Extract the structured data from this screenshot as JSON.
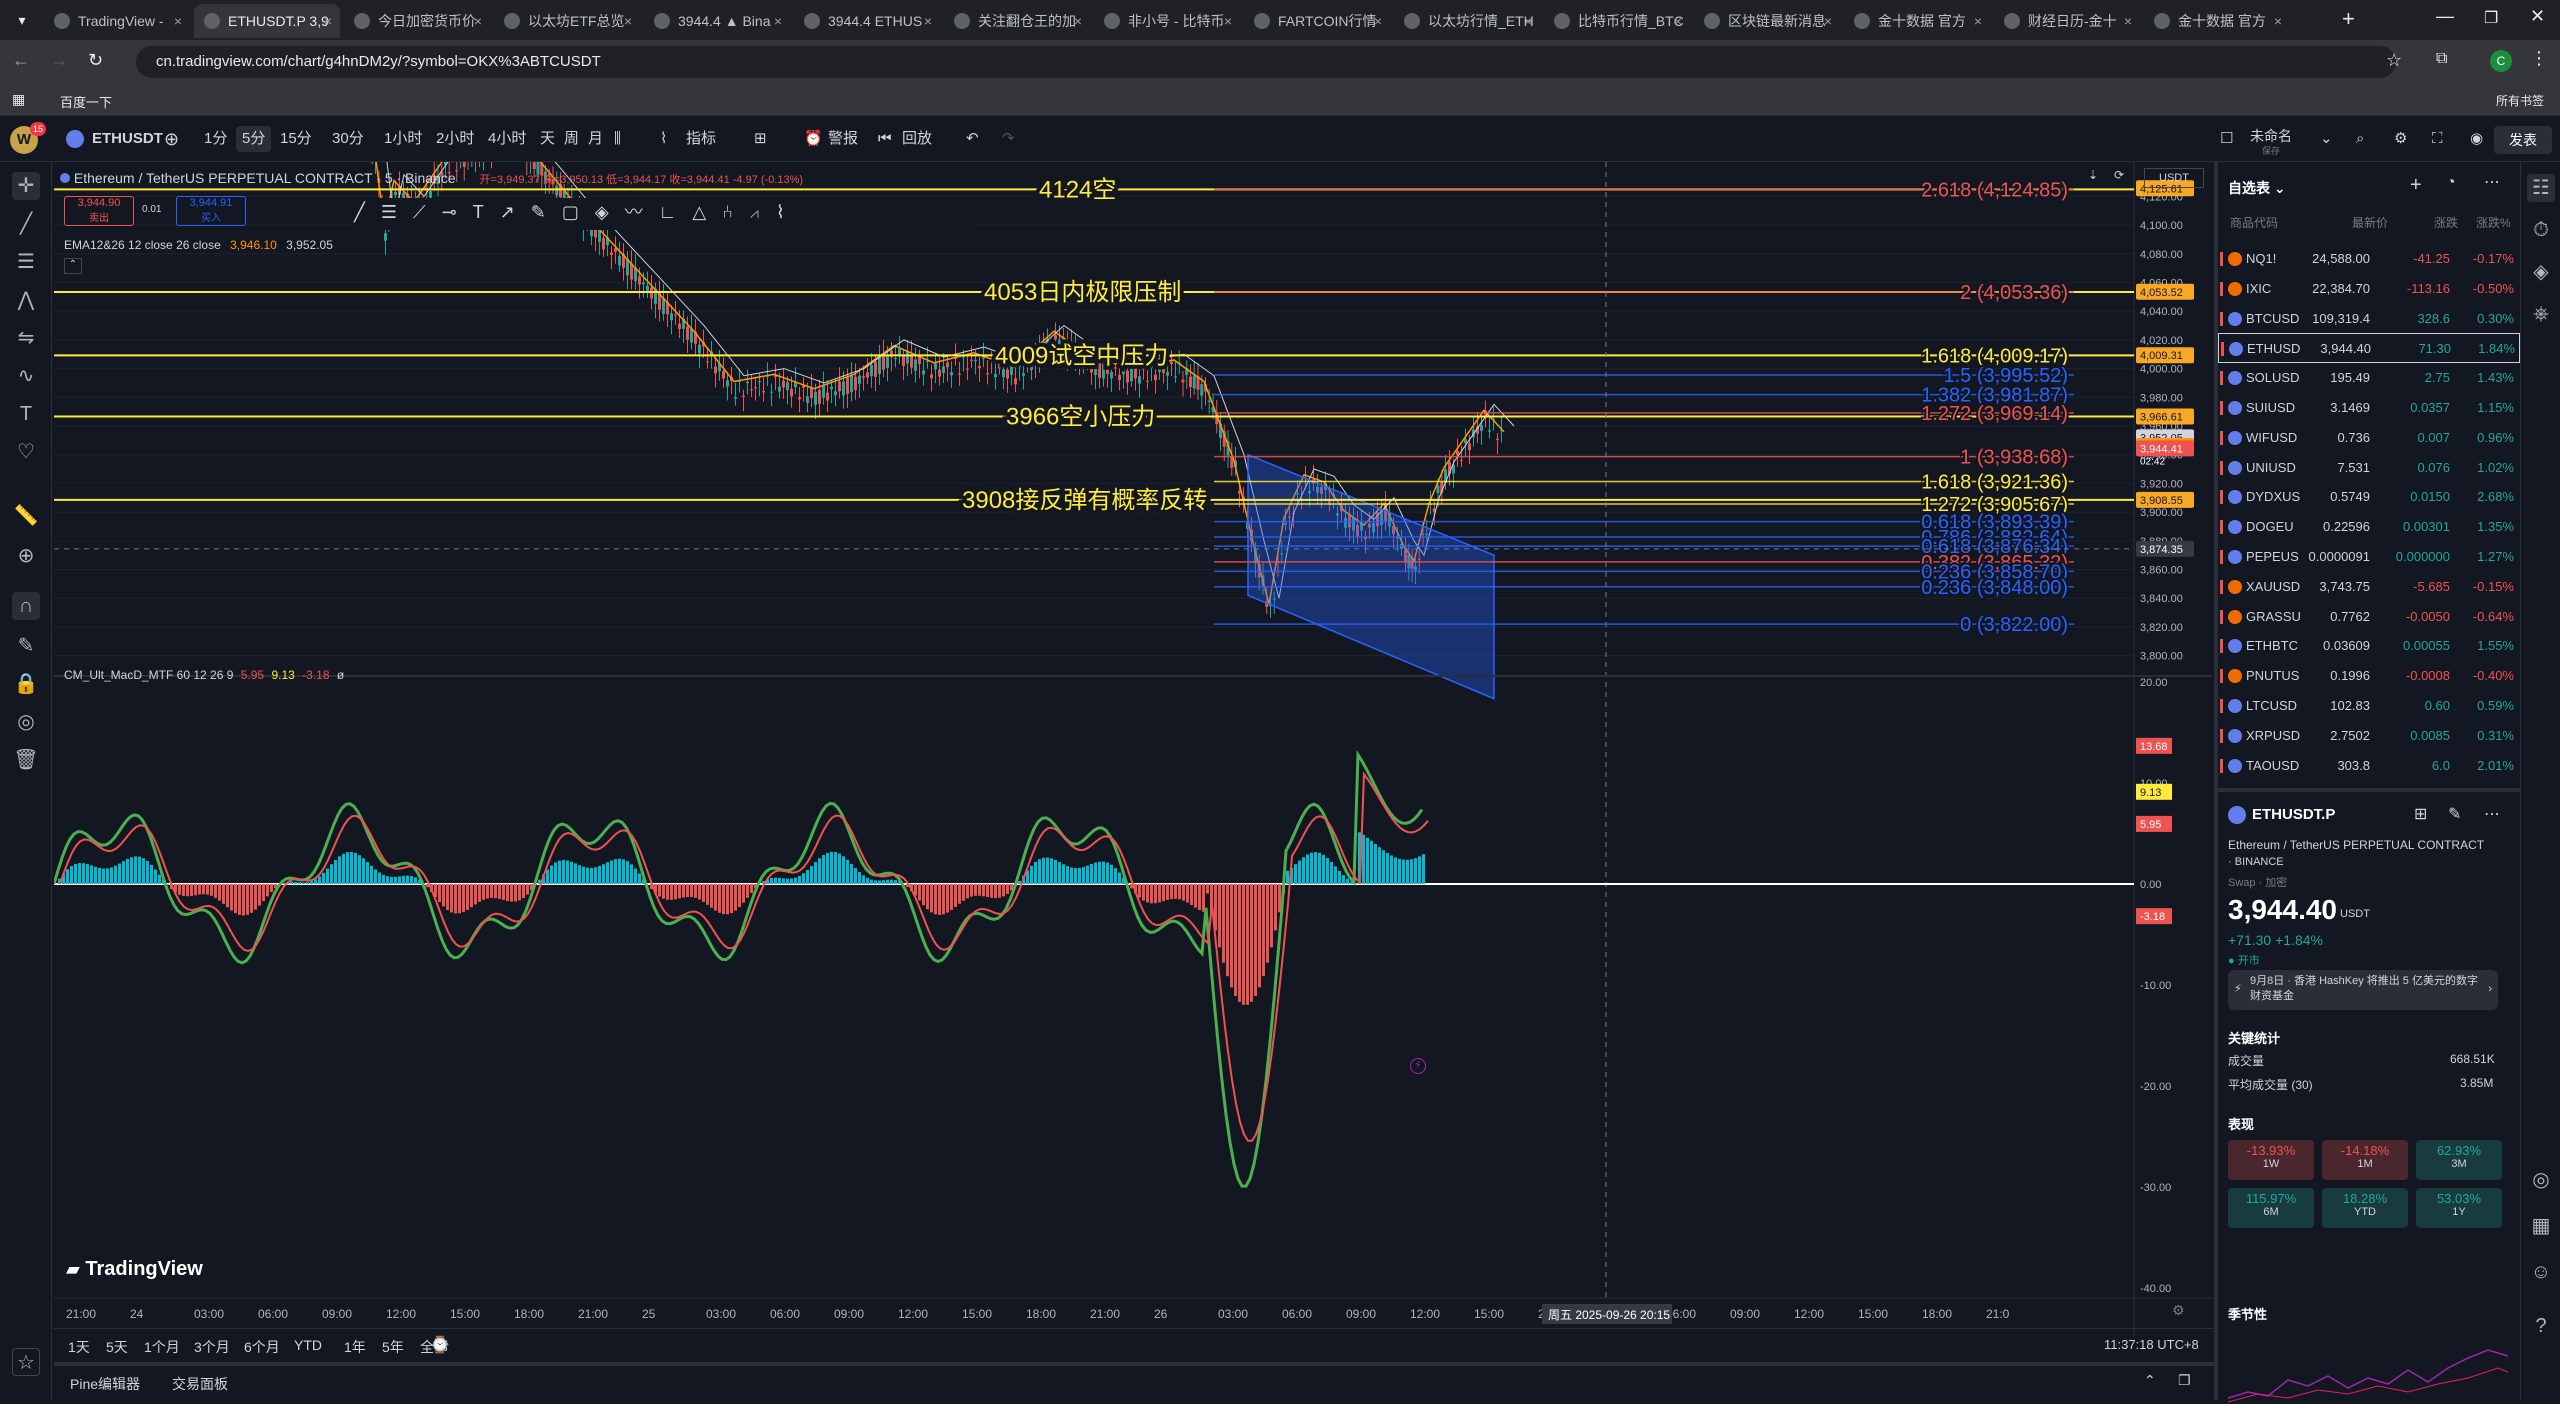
{
  "browser": {
    "tabs": [
      "TradingView -",
      "ETHUSDT.P 3,9",
      "今日加密货币价",
      "以太坊ETF总览",
      "3944.4 ▲ Bina",
      "3944.4 ETHUS",
      "关注翻仓王的加",
      "非小号 - 比特币",
      "FARTCOIN行情",
      "以太坊行情_ETH",
      "比特币行情_BTC",
      "区块链最新消息",
      "金十数据 官方",
      "财经日历-金十",
      "金十数据 官方"
    ],
    "url": "cn.tradingview.com/chart/g4hnDM2y/?symbol=OKX%3ABTCUSDT",
    "bookmark": "百度一下",
    "all_bookmarks": "所有书签"
  },
  "toolbar": {
    "symbol": "ETHUSDT",
    "intervals": [
      "1分",
      "5分",
      "15分",
      "30分",
      "1小时",
      "2小时",
      "4小时",
      "天",
      "周",
      "月"
    ],
    "selected_interval": "5分",
    "indicators": "指标",
    "alert": "警报",
    "replay": "回放",
    "layout_name": "未命名",
    "layout_sub": "保存",
    "publish": "发表"
  },
  "legend": {
    "title": "Ethereum / TetherUS PERPETUAL CONTRACT · 5 · Binance",
    "ohlc": "开=3,949.37  高=3,950.13  低=3,944.17  收=3,944.41  -4.97 (-0.13%)",
    "sell_price": "3,944.90",
    "sell_label": "卖出",
    "spread": "0.01",
    "buy_price": "3,944.91",
    "buy_label": "买入",
    "ema_label": "EMA12&26 12 close 26 close",
    "ema1": "3,946.10",
    "ema2": "3,952.05"
  },
  "chart": {
    "currency": "USDT",
    "annotations": [
      {
        "text": "4124空",
        "price": 4124.85
      },
      {
        "text": "4053日内极限压制",
        "price": 4053.36
      },
      {
        "text": "4009试空中压力",
        "price": 4009.17
      },
      {
        "text": "3966空小压力",
        "price": 3966.61
      },
      {
        "text": "3908接反弹有概率反转",
        "price": 3908.55
      }
    ],
    "fib_labels": [
      {
        "text": "2.618 (4,124.85)",
        "price": 4124.85,
        "color": "#ef5350"
      },
      {
        "text": "2 (4,053.36)",
        "price": 4053.36,
        "color": "#ef5350"
      },
      {
        "text": "1.618 (4,009.17)",
        "price": 4009.17,
        "color": "#ffeb3b"
      },
      {
        "text": "1.5 (3,995.52)",
        "price": 3995.52,
        "color": "#2962ff"
      },
      {
        "text": "1.382 (3,981.87)",
        "price": 3981.87,
        "color": "#2962ff"
      },
      {
        "text": "1.272 (3,969.14)",
        "price": 3969.14,
        "color": "#ef5350"
      },
      {
        "text": "1 (3,938.68)",
        "price": 3938.68,
        "color": "#ef5350"
      },
      {
        "text": "1.618 (3,921.36)",
        "price": 3921.36,
        "color": "#ffeb3b"
      },
      {
        "text": "1.272 (3,905.67)",
        "price": 3905.67,
        "color": "#ffeb3b"
      },
      {
        "text": "0.618 (3,893.39)",
        "price": 3893.39,
        "color": "#2962ff"
      },
      {
        "text": "0.786 (3,882.64)",
        "price": 3882.64,
        "color": "#2962ff"
      },
      {
        "text": "0.618 (3,876.34)",
        "price": 3876.34,
        "color": "#2962ff"
      },
      {
        "text": "0.382 (3,865.32)",
        "price": 3865.32,
        "color": "#ef5350"
      },
      {
        "text": "0.236 (3,858.70)",
        "price": 3858.7,
        "color": "#2962ff"
      },
      {
        "text": "0.236 (3,848.00)",
        "price": 3848.0,
        "color": "#2962ff"
      },
      {
        "text": "0 (3,822.00)",
        "price": 3822.0,
        "color": "#2962ff"
      }
    ],
    "price_ticks": [
      "4,120.00",
      "4,100.00",
      "4,080.00",
      "4,060.00",
      "4,040.00",
      "4,020.00",
      "4,000.00",
      "3,980.00",
      "3,960.00",
      "3,940.00",
      "3,920.00",
      "3,900.00",
      "3,880.00",
      "3,860.00",
      "3,840.00",
      "3,820.00",
      "3,800.00"
    ],
    "price_tags": [
      {
        "text": "4,125.61",
        "price": 4125.61,
        "bg": "#f9a825"
      },
      {
        "text": "4,053.52",
        "price": 4053.52,
        "bg": "#f9a825"
      },
      {
        "text": "4,009.31",
        "price": 4009.31,
        "bg": "#f9a825"
      },
      {
        "text": "3,966.61",
        "price": 3966.61,
        "bg": "#f9a825"
      },
      {
        "text": "3,952.05",
        "price": 3952.05,
        "bg": "#d1d4dc"
      },
      {
        "text": "3,946.10",
        "price": 3946.1,
        "bg": "#ff9800"
      },
      {
        "text": "3,944.41",
        "price": 3944.41,
        "bg": "#ef5350"
      },
      {
        "text": "3,908.55",
        "price": 3908.55,
        "bg": "#f9a825"
      },
      {
        "text": "3,874.35",
        "price": 3874.35,
        "bg": "#363a45"
      }
    ],
    "countdown": "02:42",
    "time_ticks": [
      "21:00",
      "24",
      "03:00",
      "06:00",
      "09:00",
      "12:00",
      "15:00",
      "18:00",
      "21:00",
      "25",
      "03:00",
      "06:00",
      "09:00",
      "12:00",
      "15:00",
      "18:00",
      "21:00",
      "26",
      "03:00",
      "06:00",
      "09:00",
      "12:00",
      "15:00",
      "27",
      "03:00",
      "06:00",
      "09:00",
      "12:00",
      "15:00",
      "18:00",
      "21:0"
    ],
    "crosshair_time": "周五 2025-09-26  20:15",
    "logo": "TradingView"
  },
  "macd": {
    "label": "CM_Ult_MacD_MTF 60 12 26 9",
    "v1": "5.95",
    "v2": "9.13",
    "v3": "-3.18",
    "v4": "ø",
    "ticks": [
      "20.00",
      "10.00",
      "0.00",
      "-10.00",
      "-20.00",
      "-30.00",
      "-40.00"
    ],
    "tags": [
      {
        "text": "13.68",
        "bg": "#ef5350"
      },
      {
        "text": "9.13",
        "bg": "#ffeb3b"
      },
      {
        "text": "5.95",
        "bg": "#ef5350"
      },
      {
        "text": "-3.18",
        "bg": "#ef5350"
      }
    ]
  },
  "bottom": {
    "ranges": [
      "1天",
      "5天",
      "1个月",
      "3个月",
      "6个月",
      "YTD",
      "1年",
      "5年",
      "全部"
    ],
    "clock": "11:37:18 UTC+8",
    "pine_editor": "Pine编辑器",
    "trading_panel": "交易面板"
  },
  "watchlist": {
    "title": "自选表",
    "headers": [
      "商品代码",
      "最新价",
      "涨跌",
      "涨跌%"
    ],
    "rows": [
      {
        "sym": "NQ1!",
        "price": "24,588.00",
        "chg": "-41.25",
        "pct": "-0.17%",
        "up": false
      },
      {
        "sym": "IXIC",
        "price": "22,384.70",
        "chg": "-113.16",
        "pct": "-0.50%",
        "up": false
      },
      {
        "sym": "BTCUSD",
        "price": "109,319.4",
        "chg": "328.6",
        "pct": "0.30%",
        "up": true
      },
      {
        "sym": "ETHUSD",
        "price": "3,944.40",
        "chg": "71.30",
        "pct": "1.84%",
        "up": true
      },
      {
        "sym": "SOLUSD",
        "price": "195.49",
        "chg": "2.75",
        "pct": "1.43%",
        "up": true
      },
      {
        "sym": "SUIUSD",
        "price": "3.1469",
        "chg": "0.0357",
        "pct": "1.15%",
        "up": true
      },
      {
        "sym": "WIFUSD",
        "price": "0.736",
        "chg": "0.007",
        "pct": "0.96%",
        "up": true
      },
      {
        "sym": "UNIUSD",
        "price": "7.531",
        "chg": "0.076",
        "pct": "1.02%",
        "up": true
      },
      {
        "sym": "DYDXUS",
        "price": "0.5749",
        "chg": "0.0150",
        "pct": "2.68%",
        "up": true
      },
      {
        "sym": "DOGEU",
        "price": "0.22596",
        "chg": "0.00301",
        "pct": "1.35%",
        "up": true
      },
      {
        "sym": "PEPEUS",
        "price": "0.0000091",
        "chg": "0.000000",
        "pct": "1.27%",
        "up": true
      },
      {
        "sym": "XAUUSD",
        "price": "3,743.75",
        "chg": "-5.685",
        "pct": "-0.15%",
        "up": false
      },
      {
        "sym": "GRASSU",
        "price": "0.7762",
        "chg": "-0.0050",
        "pct": "-0.64%",
        "up": false
      },
      {
        "sym": "ETHBTC",
        "price": "0.03609",
        "chg": "0.00055",
        "pct": "1.55%",
        "up": true
      },
      {
        "sym": "PNUTUS",
        "price": "0.1996",
        "chg": "-0.0008",
        "pct": "-0.40%",
        "up": false
      },
      {
        "sym": "LTCUSD",
        "price": "102.83",
        "chg": "0.60",
        "pct": "0.59%",
        "up": true
      },
      {
        "sym": "XRPUSD",
        "price": "2.7502",
        "chg": "0.0085",
        "pct": "0.31%",
        "up": true
      },
      {
        "sym": "TAOUSD",
        "price": "303.8",
        "chg": "6.0",
        "pct": "2.01%",
        "up": true
      }
    ]
  },
  "detail": {
    "symbol": "ETHUSDT.P",
    "name": "Ethereum / TetherUS PERPETUAL CONTRACT",
    "exchange": "BINANCE",
    "type": "Swap · 加密",
    "price": "3,944.40",
    "currency": "USDT",
    "change": "+71.30  +1.84%",
    "market": "开市",
    "news": "9月8日 · 香港 HashKey 将推出 5 亿美元的数字财资基金",
    "stats_title": "关键统计",
    "volume_label": "成交量",
    "volume": "668.51K",
    "avg_volume_label": "平均成交量 (30)",
    "avg_volume": "3.85M",
    "perf_title": "表现",
    "perf": [
      {
        "value": "-13.93%",
        "period": "1W",
        "up": false
      },
      {
        "value": "-14.18%",
        "period": "1M",
        "up": false
      },
      {
        "value": "62.93%",
        "period": "3M",
        "up": true
      },
      {
        "value": "115.97%",
        "period": "6M",
        "up": true
      },
      {
        "value": "18.28%",
        "period": "YTD",
        "up": true
      },
      {
        "value": "53.03%",
        "period": "1Y",
        "up": true
      }
    ],
    "seasonal_title": "季节性"
  },
  "colors": {
    "bg": "#131722",
    "grid": "#1e222d",
    "up": "#26a69a",
    "down": "#ef5350",
    "annot": "#ffeb3b",
    "fib_blue": "#2962ff"
  }
}
